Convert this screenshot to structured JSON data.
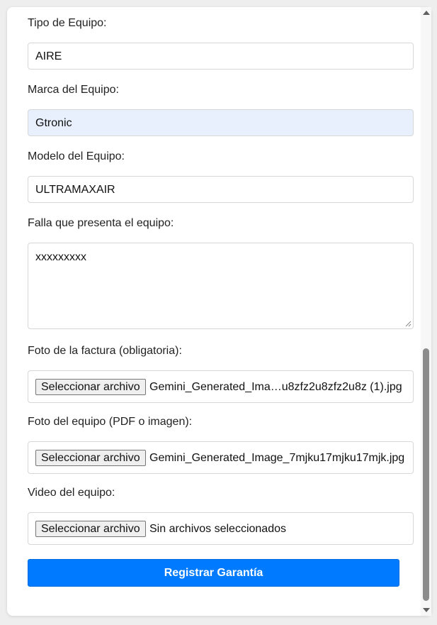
{
  "form": {
    "tipo": {
      "label": "Tipo de Equipo:",
      "value": "AIRE"
    },
    "marca": {
      "label": "Marca del Equipo:",
      "value": "Gtronic"
    },
    "modelo": {
      "label": "Modelo del Equipo:",
      "value": "ULTRAMAXAIR"
    },
    "falla": {
      "label": "Falla que presenta el equipo:",
      "value": "xxxxxxxxx"
    },
    "factura": {
      "label": "Foto de la factura (obligatoria):",
      "button": "Seleccionar archivo",
      "file": "Gemini_Generated_Ima…u8zfz2u8zfz2u8z (1).jpg"
    },
    "foto": {
      "label": "Foto del equipo (PDF o imagen):",
      "button": "Seleccionar archivo",
      "file": "Gemini_Generated_Image_7mjku17mjku17mjk.jpg"
    },
    "video": {
      "label": "Video del equipo:",
      "button": "Seleccionar archivo",
      "file": "Sin archivos seleccionados"
    },
    "submit": "Registrar Garantía"
  },
  "colors": {
    "primary": "#007bff",
    "autofill": "#e8f0fe"
  }
}
